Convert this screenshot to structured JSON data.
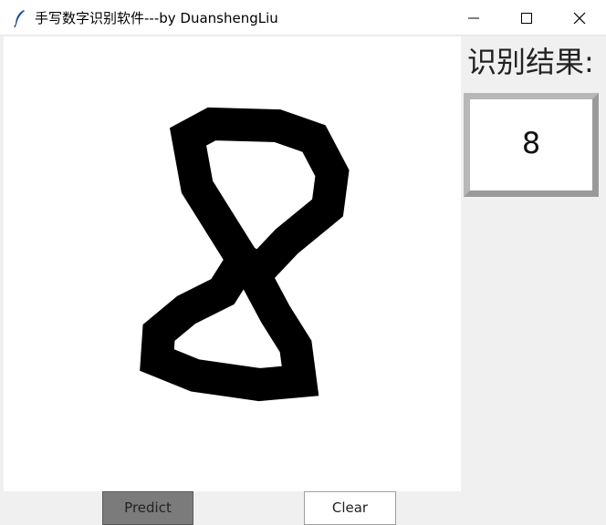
{
  "window": {
    "title": "手写数字识别软件---by DuanshengLiu",
    "icon": "feather-icon",
    "controls": [
      "minimize-icon",
      "maximize-icon",
      "close-icon"
    ]
  },
  "result": {
    "label": "识别结果:",
    "value": "8"
  },
  "buttons": {
    "predict_label": "Predict",
    "clear_label": "Clear"
  },
  "colors": {
    "window_bg": "#f0f0f0",
    "canvas_bg": "#ffffff",
    "ink": "#000000",
    "predict_button_bg": "#7b7b7b",
    "clear_button_bg": "#ffffff"
  }
}
